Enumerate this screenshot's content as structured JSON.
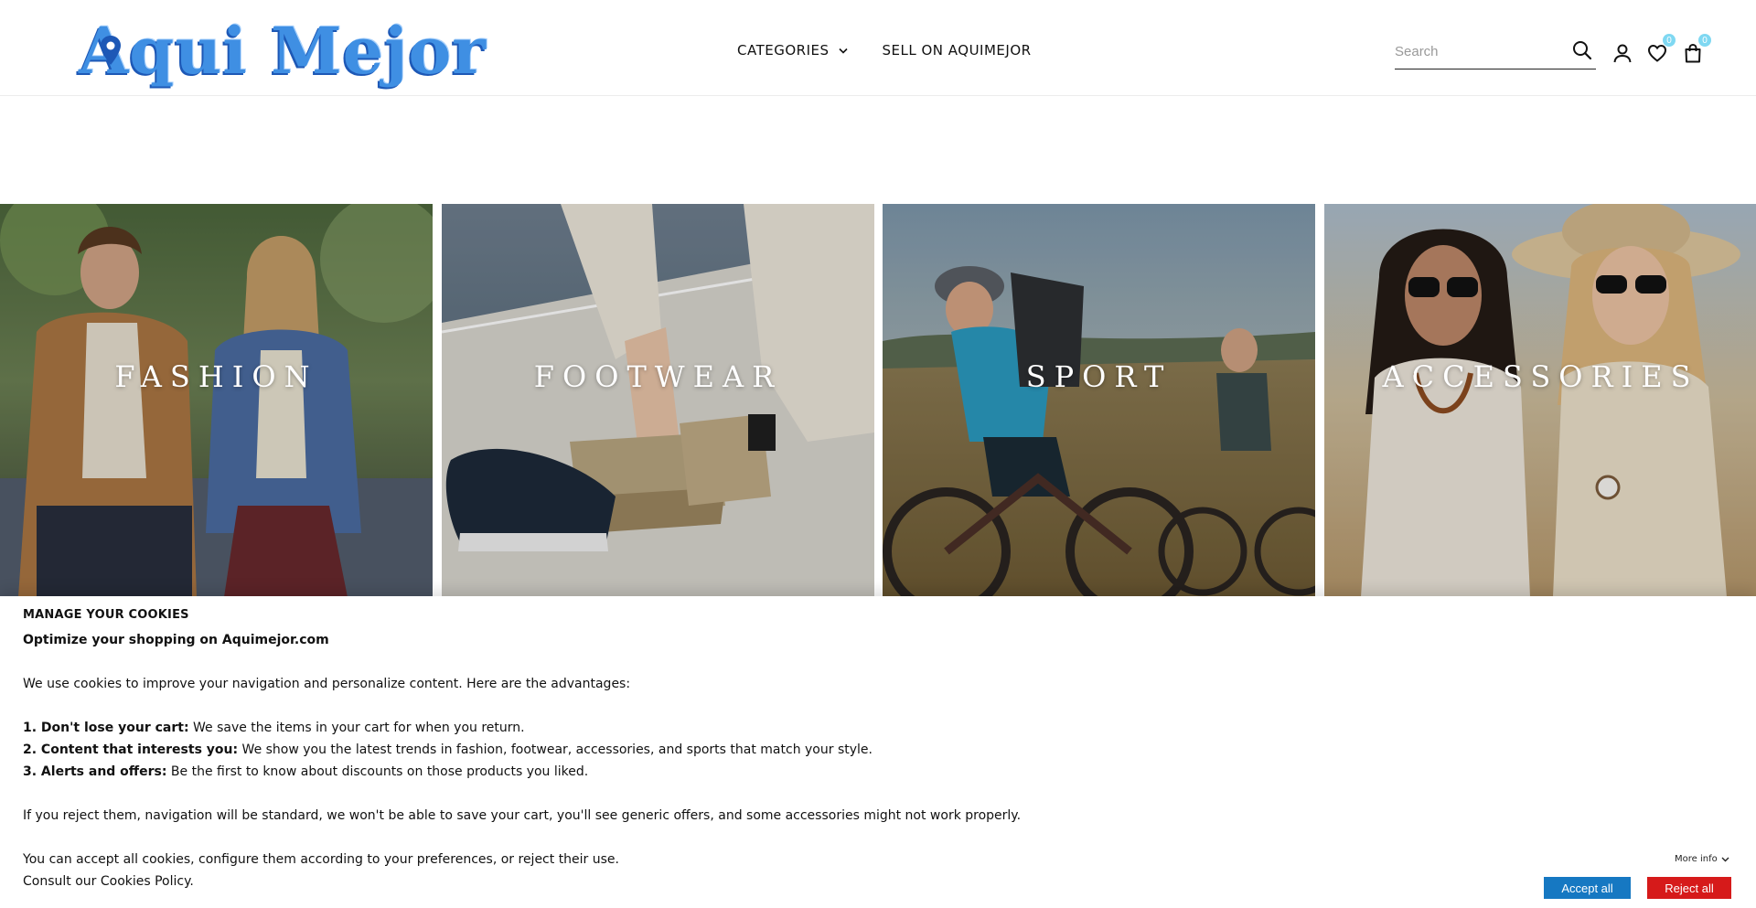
{
  "header": {
    "logo_text": "Aqui Mejor",
    "nav": {
      "categories": "CATEGORIES",
      "sell": "SELL ON AQUIMEJOR"
    },
    "search_placeholder": "Search",
    "wishlist_count": "0",
    "cart_count": "0"
  },
  "tiles": [
    {
      "label": "FASHION"
    },
    {
      "label": "FOOTWEAR"
    },
    {
      "label": "SPORT"
    },
    {
      "label": "ACCESSORIES"
    }
  ],
  "cookies": {
    "title": "MANAGE YOUR COOKIES",
    "subtitle": "Optimize your shopping on Aquimejor.com",
    "intro": "We use cookies to improve your navigation and personalize content. Here are the advantages:",
    "benefits": [
      {
        "lead": "1. Don't lose your cart:",
        "text": " We save the items in your cart for when you return."
      },
      {
        "lead": "2. Content that interests you:",
        "text": " We show you the latest trends in fashion, footwear, accessories, and sports that match your style."
      },
      {
        "lead": "3. Alerts and offers:",
        "text": " Be the first to know about discounts on those products you liked."
      }
    ],
    "reject_note": "If you reject them, navigation will be standard, we won't be able to save your cart, you'll see generic offers, and some accessories might not work properly.",
    "choice_note": "You can accept all cookies, configure them according to your preferences, or reject their use.",
    "policy_note": "Consult our Cookies Policy.",
    "more_info": "More info",
    "accept_label": "Accept all",
    "reject_label": "Reject all"
  },
  "colors": {
    "brand_blue": "#3f8fe3",
    "accept_blue": "#1678c2",
    "reject_red": "#d61a1a",
    "badge": "#7fd8f2"
  }
}
